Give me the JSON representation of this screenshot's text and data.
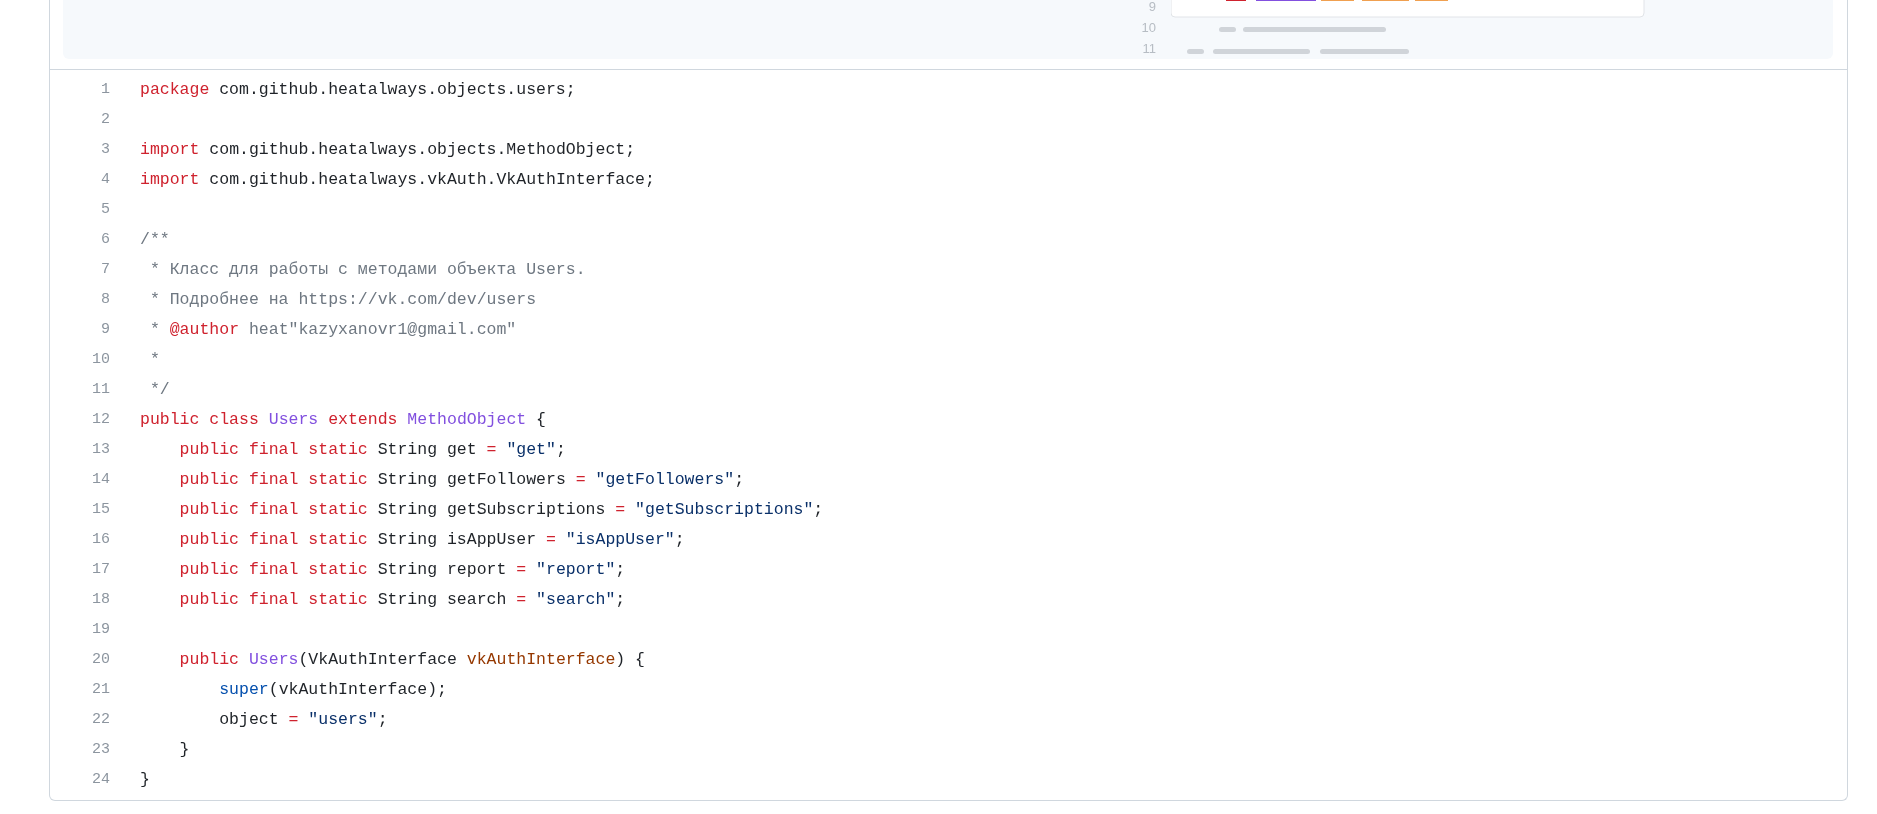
{
  "banner": {
    "line_numbers": [
      "9",
      "10",
      "11"
    ]
  },
  "code": {
    "lines": [
      {
        "number": "1",
        "tokens": [
          {
            "kind": "keyword",
            "text": "package"
          },
          {
            "kind": "plain",
            "text": " com.github.heatalways.objects.users;"
          }
        ]
      },
      {
        "number": "2"
      },
      {
        "number": "3",
        "tokens": [
          {
            "kind": "keyword",
            "text": "import"
          },
          {
            "kind": "plain",
            "text": " com.github.heatalways.objects.MethodObject;"
          }
        ]
      },
      {
        "number": "4",
        "tokens": [
          {
            "kind": "keyword",
            "text": "import"
          },
          {
            "kind": "plain",
            "text": " com.github.heatalways.vkAuth.VkAuthInterface;"
          }
        ]
      },
      {
        "number": "5"
      },
      {
        "number": "6",
        "tokens": [
          {
            "kind": "comment",
            "text": "/**"
          }
        ]
      },
      {
        "number": "7",
        "tokens": [
          {
            "kind": "comment",
            "text": " * Класс для работы с методами объекта Users."
          }
        ]
      },
      {
        "number": "8",
        "tokens": [
          {
            "kind": "comment",
            "text": " * Подробнее на https://vk.com/dev/users"
          }
        ]
      },
      {
        "number": "9",
        "tokens": [
          {
            "kind": "comment",
            "text": " * "
          },
          {
            "kind": "keyword",
            "text": "@author"
          },
          {
            "kind": "comment",
            "text": " heat\"kazyxanovr1@gmail.com\""
          }
        ]
      },
      {
        "number": "10",
        "tokens": [
          {
            "kind": "comment",
            "text": " *"
          }
        ]
      },
      {
        "number": "11",
        "tokens": [
          {
            "kind": "comment",
            "text": " */"
          }
        ]
      },
      {
        "number": "12",
        "tokens": [
          {
            "kind": "keyword",
            "text": "public class"
          },
          {
            "kind": "entity",
            "text": " Users"
          },
          {
            "kind": "keyword",
            "text": " extends"
          },
          {
            "kind": "entity",
            "text": " MethodObject"
          },
          {
            "kind": "plain",
            "text": " {"
          }
        ]
      },
      {
        "number": "13",
        "tokens": [
          {
            "kind": "keyword",
            "text": "    public final static"
          },
          {
            "kind": "plain",
            "text": " String get "
          },
          {
            "kind": "keyword",
            "text": "="
          },
          {
            "kind": "string",
            "text": " \"get\""
          },
          {
            "kind": "plain",
            "text": ";"
          }
        ]
      },
      {
        "number": "14",
        "tokens": [
          {
            "kind": "keyword",
            "text": "    public final static"
          },
          {
            "kind": "plain",
            "text": " String getFollowers "
          },
          {
            "kind": "keyword",
            "text": "="
          },
          {
            "kind": "string",
            "text": " \"getFollowers\""
          },
          {
            "kind": "plain",
            "text": ";"
          }
        ]
      },
      {
        "number": "15",
        "tokens": [
          {
            "kind": "keyword",
            "text": "    public final static"
          },
          {
            "kind": "plain",
            "text": " String getSubscriptions "
          },
          {
            "kind": "keyword",
            "text": "="
          },
          {
            "kind": "string",
            "text": " \"getSubscriptions\""
          },
          {
            "kind": "plain",
            "text": ";"
          }
        ]
      },
      {
        "number": "16",
        "tokens": [
          {
            "kind": "keyword",
            "text": "    public final static"
          },
          {
            "kind": "plain",
            "text": " String isAppUser "
          },
          {
            "kind": "keyword",
            "text": "="
          },
          {
            "kind": "string",
            "text": " \"isAppUser\""
          },
          {
            "kind": "plain",
            "text": ";"
          }
        ]
      },
      {
        "number": "17",
        "tokens": [
          {
            "kind": "keyword",
            "text": "    public final static"
          },
          {
            "kind": "plain",
            "text": " String report "
          },
          {
            "kind": "keyword",
            "text": "="
          },
          {
            "kind": "string",
            "text": " \"report\""
          },
          {
            "kind": "plain",
            "text": ";"
          }
        ]
      },
      {
        "number": "18",
        "tokens": [
          {
            "kind": "keyword",
            "text": "    public final static"
          },
          {
            "kind": "plain",
            "text": " String search "
          },
          {
            "kind": "keyword",
            "text": "="
          },
          {
            "kind": "string",
            "text": " \"search\""
          },
          {
            "kind": "plain",
            "text": ";"
          }
        ]
      },
      {
        "number": "19"
      },
      {
        "number": "20",
        "tokens": [
          {
            "kind": "keyword",
            "text": "    public"
          },
          {
            "kind": "entity",
            "text": " Users"
          },
          {
            "kind": "plain",
            "text": "(VkAuthInterface "
          },
          {
            "kind": "variable",
            "text": "vkAuthInterface"
          },
          {
            "kind": "plain",
            "text": ") {"
          }
        ]
      },
      {
        "number": "21",
        "tokens": [
          {
            "kind": "function",
            "text": "        super"
          },
          {
            "kind": "plain",
            "text": "(vkAuthInterface);"
          }
        ]
      },
      {
        "number": "22",
        "tokens": [
          {
            "kind": "plain",
            "text": "        object "
          },
          {
            "kind": "keyword",
            "text": "="
          },
          {
            "kind": "string",
            "text": " \"users\""
          },
          {
            "kind": "plain",
            "text": ";"
          }
        ]
      },
      {
        "number": "23",
        "tokens": [
          {
            "kind": "plain",
            "text": "    }"
          }
        ]
      },
      {
        "number": "24",
        "tokens": [
          {
            "kind": "plain",
            "text": "}"
          }
        ]
      }
    ]
  }
}
